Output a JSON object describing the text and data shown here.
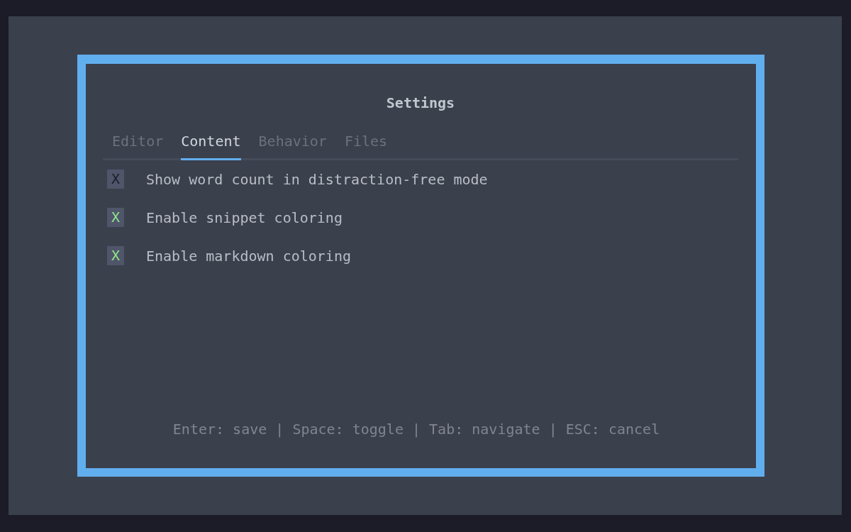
{
  "dialog": {
    "title": "Settings"
  },
  "tabs": [
    {
      "label": "Editor",
      "selected": false
    },
    {
      "label": "Content",
      "selected": true
    },
    {
      "label": "Behavior",
      "selected": false
    },
    {
      "label": "Files",
      "selected": false
    }
  ],
  "options": [
    {
      "mark": "X",
      "label": "Show word count in distraction-free mode",
      "checked": false
    },
    {
      "mark": "X",
      "label": "Enable snippet coloring",
      "checked": true
    },
    {
      "mark": "X",
      "label": "Enable markdown coloring",
      "checked": true
    }
  ],
  "footer": "Enter: save | Space: toggle | Tab: navigate | ESC: cancel"
}
